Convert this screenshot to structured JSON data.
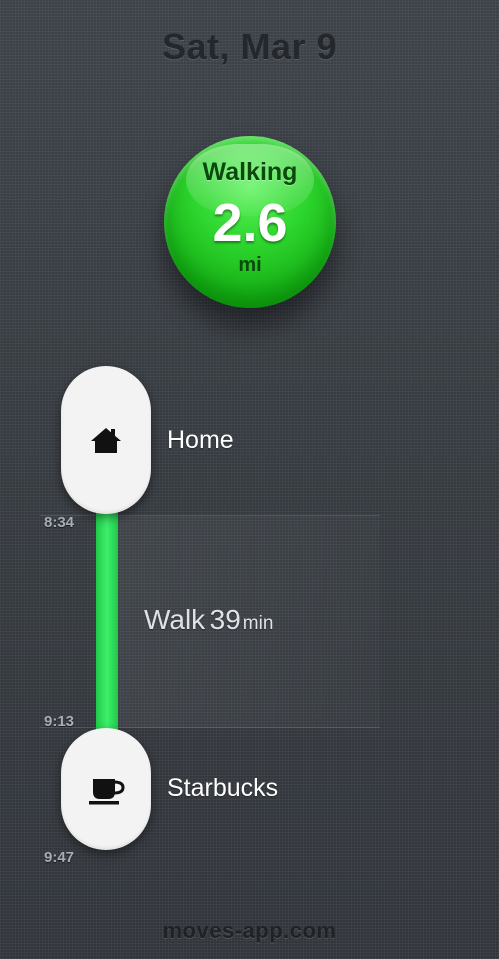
{
  "header": {
    "date": "Sat, Mar 9"
  },
  "summary": {
    "activity": "Walking",
    "distance": "2.6",
    "unit": "mi",
    "color": "#2ed62e"
  },
  "timeline": {
    "bar_color": "#3ef06a",
    "places": [
      {
        "name": "Home",
        "icon": "home-icon"
      },
      {
        "name": "Starbucks",
        "icon": "coffee-cup-icon"
      }
    ],
    "times": [
      "8:34",
      "9:13",
      "9:47"
    ],
    "activity": {
      "name": "Walk",
      "duration": "39",
      "unit": "min"
    }
  },
  "footer": {
    "link": "moves-app.com"
  }
}
